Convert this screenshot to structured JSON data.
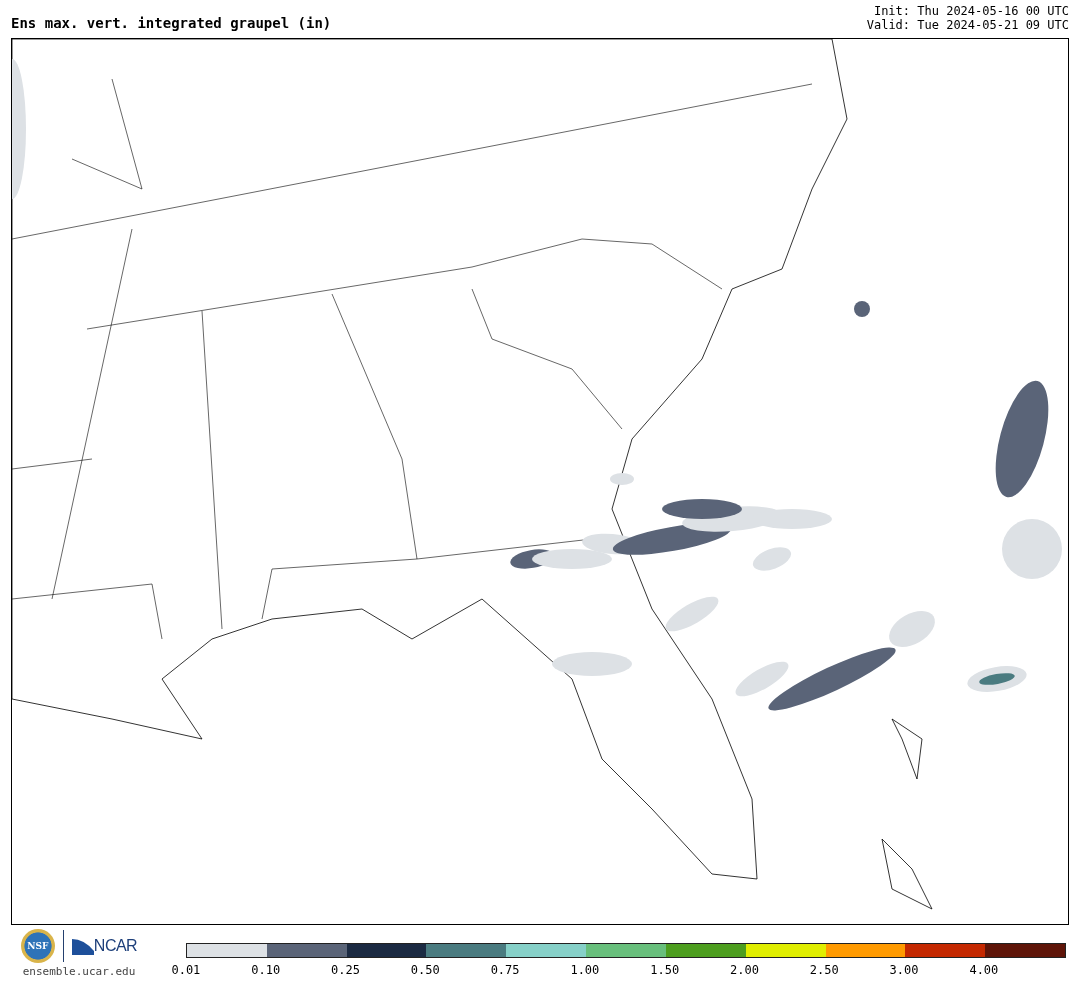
{
  "title": "Ens max. vert. integrated graupel (in)",
  "init": "Init: Thu 2024-05-16 00 UTC",
  "valid": "Valid: Tue 2024-05-21 09 UTC",
  "logos": {
    "nsf": "NSF",
    "ncar": "NCAR",
    "site": "ensemble.ucar.edu"
  },
  "colorbar": {
    "bins": [
      {
        "color": "#dde1e5"
      },
      {
        "color": "#5a6478"
      },
      {
        "color": "#1b2a42"
      },
      {
        "color": "#4a7b80"
      },
      {
        "color": "#86d0c8"
      },
      {
        "color": "#68bf7c"
      },
      {
        "color": "#4d9e1f"
      },
      {
        "color": "#e0ee00"
      },
      {
        "color": "#ff9a00"
      },
      {
        "color": "#c42800"
      },
      {
        "color": "#5e1408"
      }
    ],
    "labels": [
      "0.01",
      "0.10",
      "0.25",
      "0.50",
      "0.75",
      "1.00",
      "1.50",
      "2.00",
      "2.50",
      "3.00",
      "4.00"
    ]
  }
}
